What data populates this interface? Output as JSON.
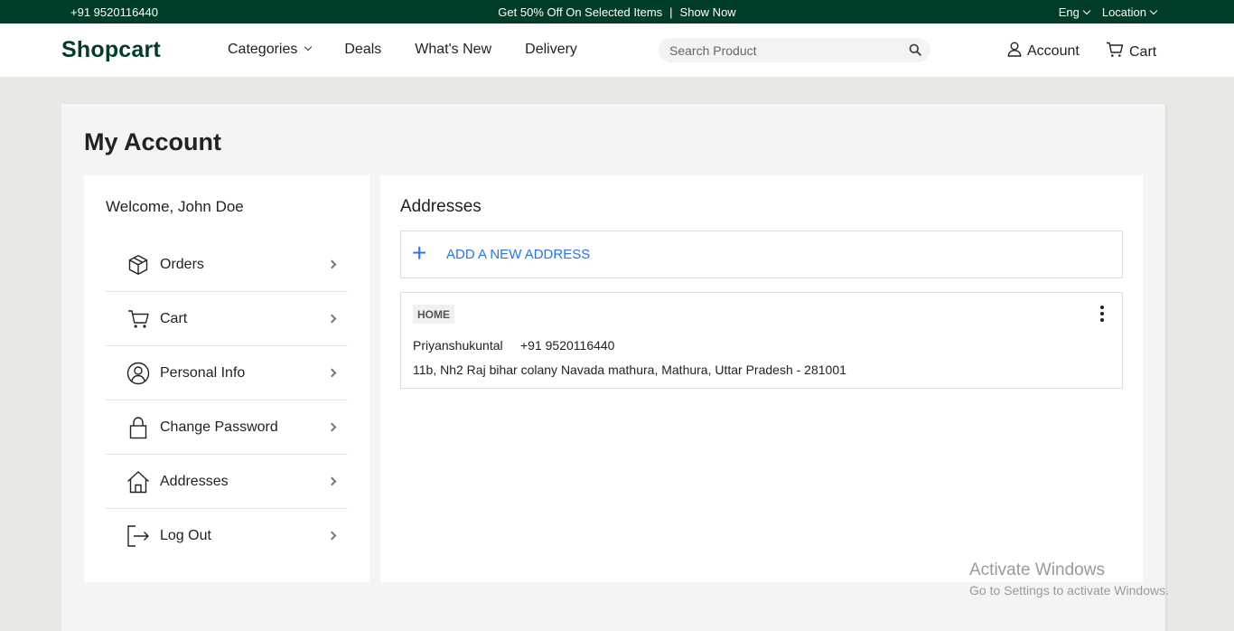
{
  "topbar": {
    "phone": "+91 9520116440",
    "promo": "Get 50% Off On Selected Items",
    "promo_sep": "|",
    "promo_cta": "Show Now",
    "language": "Eng",
    "location": "Location"
  },
  "header": {
    "logo": "Shopcart",
    "nav": [
      {
        "label": "Categories",
        "has_dropdown": true
      },
      {
        "label": "Deals"
      },
      {
        "label": "What's New"
      },
      {
        "label": "Delivery"
      }
    ],
    "search_placeholder": "Search Product",
    "account_label": "Account",
    "cart_label": "Cart"
  },
  "page": {
    "title": "My Account",
    "sidebar": {
      "welcome": "Welcome, John Doe",
      "items": [
        {
          "label": "Orders",
          "icon": "box-icon"
        },
        {
          "label": "Cart",
          "icon": "cart-icon"
        },
        {
          "label": "Personal Info",
          "icon": "user-circle-icon"
        },
        {
          "label": "Change Password",
          "icon": "lock-icon"
        },
        {
          "label": "Addresses",
          "icon": "home-icon"
        },
        {
          "label": "Log Out",
          "icon": "logout-icon"
        }
      ]
    },
    "addresses": {
      "title": "Addresses",
      "add_label": "ADD A NEW ADDRESS",
      "list": [
        {
          "type": "HOME",
          "name": "Priyanshukuntal",
          "phone": "+91 9520116440",
          "address": "11b, Nh2 Raj bihar colany Navada mathura, Mathura, Uttar Pradesh - 281001"
        }
      ]
    }
  },
  "watermark": {
    "line1": "Activate Windows",
    "line2": "Go to Settings to activate Windows."
  },
  "colors": {
    "brand": "#003d29",
    "link": "#2874f0",
    "background": "#e9e8e4"
  }
}
